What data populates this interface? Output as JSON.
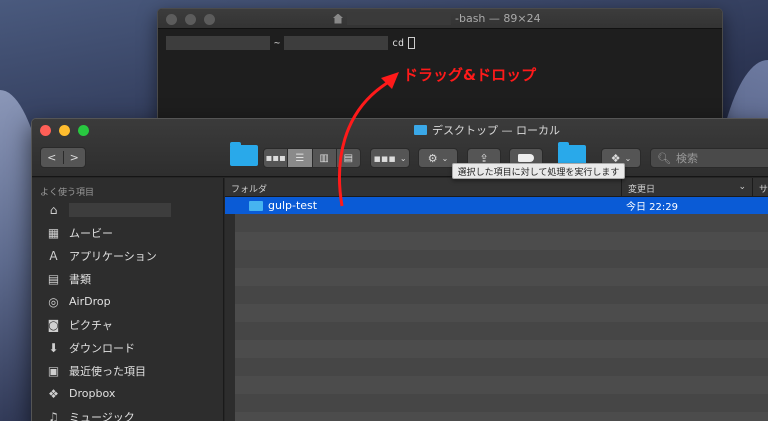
{
  "terminal": {
    "title_suffix": "-bash — 89×24",
    "prompt_sep": "~",
    "command": "cd"
  },
  "finder": {
    "title": "デスクトップ — ローカル",
    "nav_back": "<",
    "nav_forward": ">",
    "search_placeholder": "検索",
    "tooltip": "選択した項目に対して処理を実行します",
    "sidebar_heading": "よく使う項目",
    "sidebar_items": [
      {
        "label": "",
        "icon": "home-icon"
      },
      {
        "label": "ムービー",
        "icon": "film-icon"
      },
      {
        "label": "アプリケーション",
        "icon": "apps-icon"
      },
      {
        "label": "書類",
        "icon": "document-icon"
      },
      {
        "label": "AirDrop",
        "icon": "airdrop-icon"
      },
      {
        "label": "ピクチャ",
        "icon": "camera-icon"
      },
      {
        "label": "ダウンロード",
        "icon": "download-icon"
      },
      {
        "label": "最近使った項目",
        "icon": "recents-icon"
      },
      {
        "label": "Dropbox",
        "icon": "dropbox-icon"
      },
      {
        "label": "ミュージック",
        "icon": "music-icon"
      }
    ],
    "columns": {
      "name": "フォルダ",
      "date": "変更日",
      "more": "サ"
    },
    "rows": [
      {
        "name": "gulp-test",
        "date": "今日 22:29",
        "selected": true
      }
    ]
  },
  "annotation": {
    "text": "ドラッグ&ドロップ",
    "color": "#ff1a1a"
  },
  "colors": {
    "selection": "#0a5bd6",
    "folder": "#29a9ea"
  }
}
